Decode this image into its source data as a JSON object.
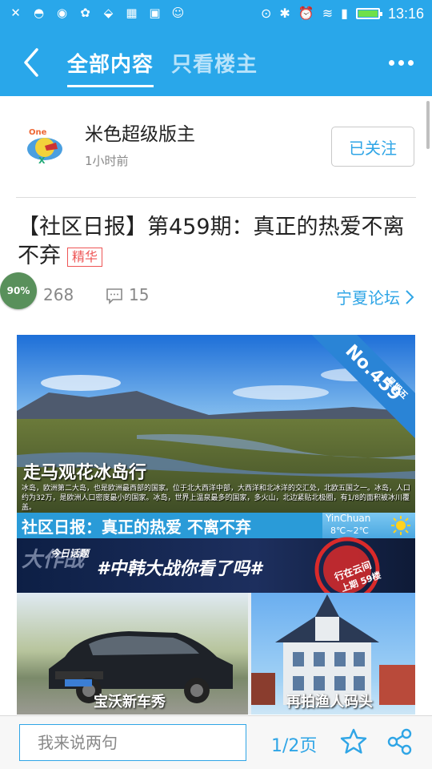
{
  "status_bar": {
    "time": "13:16",
    "left_icons": [
      "wechat-icon",
      "speech-bubble-icon",
      "qq-icon",
      "paw-icon",
      "location-icon",
      "apps-icon",
      "image-icon",
      "emoji-icon"
    ],
    "right_icons": [
      "location-icon",
      "bluetooth-icon",
      "alarm-icon",
      "wifi-icon",
      "signal-icon",
      "battery-icon"
    ],
    "battery_level": 1.0,
    "battery_color": "#6fe04a"
  },
  "header": {
    "tabs": [
      {
        "label": "全部内容",
        "active": true
      },
      {
        "label": "只看楼主",
        "active": false
      }
    ],
    "accent": "#29a7ea"
  },
  "author": {
    "name": "米色超级版主",
    "time": "1小时前",
    "follow_label": "已关注"
  },
  "post": {
    "title": "【社区日报】第459期：真正的热爱不离不弃",
    "badge": "精华",
    "views": "268",
    "comments": "15",
    "forum": "宁夏论坛",
    "progress_badge": "90%"
  },
  "banner": {
    "title": "走马观花冰岛行",
    "description": "冰岛，欧洲第二大岛，也是欧洲最西部的国家。位于北大西洋中部，大西洋和北冰洋的交汇处，北欧五国之一。冰岛，人口约为32万，是欧洲人口密度最小的国家。冰岛，世界上温泉最多的国家，多火山，北边紧贴北极圈，有1/8的面积被冰川覆盖。",
    "issue": "No.459",
    "weekday": "星期五",
    "strip_title": "社区日报：真正的热爱 不离不弃",
    "weather_city": "YinChuan",
    "weather_temp": "8℃~2℃",
    "topic_label": "今日话题",
    "topic": "#中韩大战你看了吗#",
    "topic_big": "大作战",
    "stamp_line1": "行在云间",
    "stamp_line2": "上期 59楼",
    "caption_left": "宝沃新车秀",
    "caption_right": "再拍渔人码头"
  },
  "bottom_bar": {
    "input_placeholder": "我来说两句",
    "page": "1/2页"
  }
}
